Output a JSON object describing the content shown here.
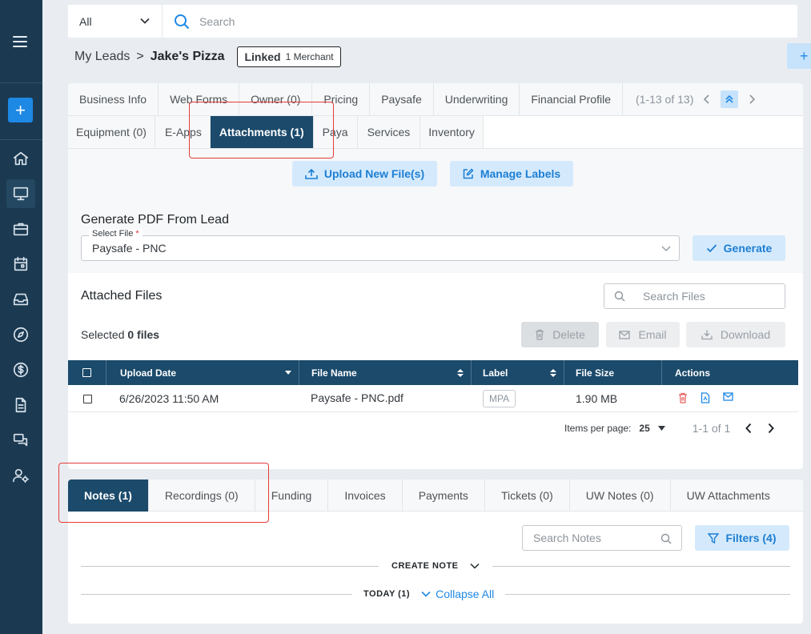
{
  "topbar": {
    "scope_value": "All",
    "search_placeholder": "Search"
  },
  "breadcrumb": {
    "parent": "My Leads",
    "separator": ">",
    "current": "Jake's Pizza",
    "linked_label": "Linked",
    "linked_count": "1 Merchant"
  },
  "corner_button": "+",
  "tabs_row1": [
    "Business Info",
    "Web Forms",
    "Owner (0)",
    "Pricing",
    "Paysafe",
    "Underwriting",
    "Financial Profile"
  ],
  "tabs_pager": "(1-13 of 13)",
  "tabs_row2": [
    "Equipment (0)",
    "E-Apps",
    "Attachments (1)",
    "Paya",
    "Services",
    "Inventory"
  ],
  "active_tab": "Attachments (1)",
  "upload_button": "Upload New File(s)",
  "manage_labels_button": "Manage Labels",
  "generate_pdf": {
    "title": "Generate PDF From Lead",
    "field_label": "Select File",
    "required_mark": "*",
    "selected_value": "Paysafe - PNC",
    "generate_button": "Generate"
  },
  "attached": {
    "title": "Attached Files",
    "search_placeholder": "Search Files",
    "selected_prefix": "Selected",
    "selected_count": "0 files",
    "delete_button": "Delete",
    "email_button": "Email",
    "download_button": "Download"
  },
  "table": {
    "columns": [
      "Upload Date",
      "File Name",
      "Label",
      "File Size",
      "Actions"
    ],
    "rows": [
      {
        "upload_date": "6/26/2023 11:50 AM",
        "file_name": "Paysafe - PNC.pdf",
        "label": "MPA",
        "file_size": "1.90 MB"
      }
    ],
    "items_per_page_label": "Items per page:",
    "items_per_page": "25",
    "range": "1-1 of 1"
  },
  "notes_tabs": [
    "Notes (1)",
    "Recordings (0)",
    "Funding",
    "Invoices",
    "Payments",
    "Tickets (0)",
    "UW Notes (0)",
    "UW Attachments"
  ],
  "notes": {
    "search_placeholder": "Search Notes",
    "filters_button": "Filters (4)",
    "create_note": "CREATE NOTE",
    "today_label": "TODAY (1)",
    "collapse_all": "Collapse All"
  },
  "colors": {
    "sidebar": "#1b3a52",
    "header_navy": "#1b4a6b",
    "accent_blue": "#1e88e5",
    "light_blue_button": "#d4eafc",
    "highlight_red": "#e63b3b"
  }
}
